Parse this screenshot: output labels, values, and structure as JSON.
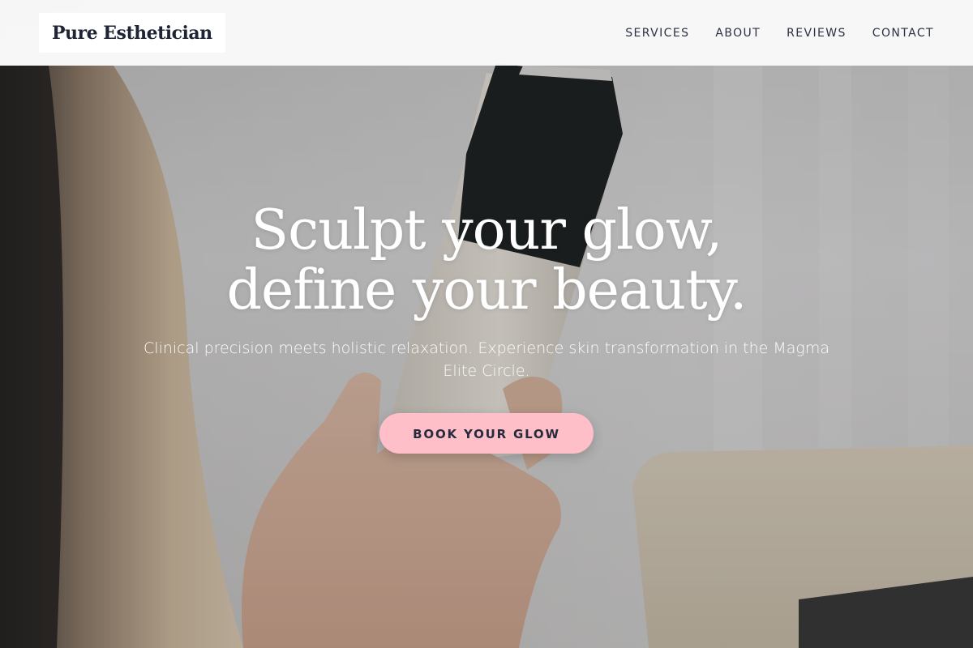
{
  "header": {
    "logo": "Pure Esthetician",
    "nav": [
      {
        "label": "SERVICES"
      },
      {
        "label": "ABOUT"
      },
      {
        "label": "REVIEWS"
      },
      {
        "label": "CONTACT"
      }
    ]
  },
  "hero": {
    "title_line1": "Sculpt your glow,",
    "title_line2": "define your beauty.",
    "subtitle": "Clinical precision meets holistic relaxation. Experience skin transformation in the Magma Elite Circle.",
    "cta": "BOOK YOUR GLOW"
  },
  "colors": {
    "accent": "#ffbfc8",
    "text_dark": "#262b3d",
    "header_bg": "#fafafa"
  }
}
